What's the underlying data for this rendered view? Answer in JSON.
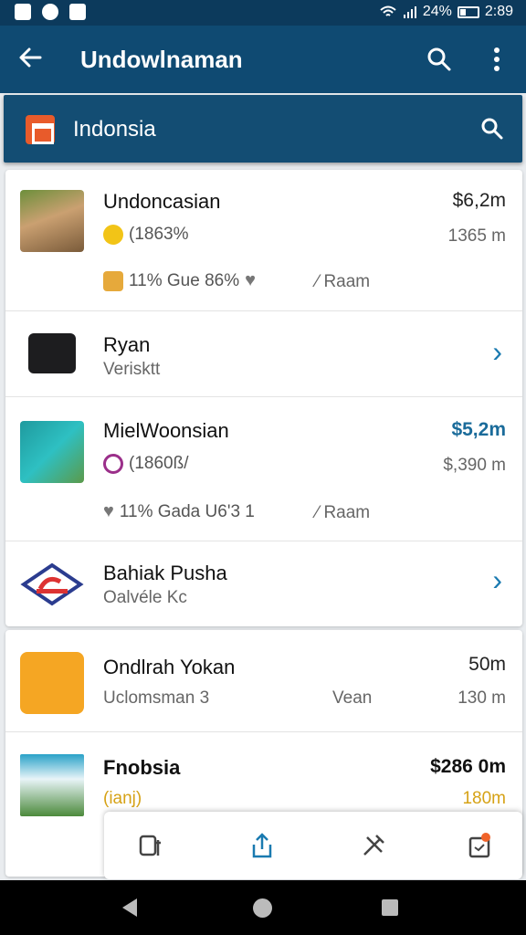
{
  "status_bar": {
    "battery": "24%",
    "time": "2:89"
  },
  "app_bar": {
    "title": "Undowlnaman",
    "back_icon": "arrow-left-icon",
    "search_icon": "search-icon",
    "more_icon": "more-vert-icon"
  },
  "sub_bar": {
    "label": "Indonsia"
  },
  "items": [
    {
      "name": "Undoncasian",
      "sub": "(1863%",
      "price": "$6,2m",
      "sub_right": "1365 m",
      "meta_left": "11% Gue 86%",
      "meta_right": "Raam"
    },
    {
      "name": "Ryan",
      "sub": "Verisktt"
    },
    {
      "name": "MielWoonsian",
      "sub": "(1860ß/",
      "price": "$5,2m",
      "sub_right": "$,390 m",
      "meta_left": "11% Gada U6'3 1",
      "meta_right": "Raam"
    },
    {
      "name": "Bahiak Pusha",
      "sub": "Oalvéle Kc"
    },
    {
      "name": "Ondlrah Yokan",
      "sub": "Uclomsman 3",
      "sub_mid": "Vean",
      "price": "50m",
      "sub_right": "130 m"
    },
    {
      "name": "Fnobsia",
      "sub": "(ianj)",
      "price": "$286 0m",
      "sub_right": "180m"
    }
  ],
  "colors": {
    "app_bar": "#0f4a72",
    "accent_blue": "#1a7ab0",
    "orange": "#f5a623"
  }
}
